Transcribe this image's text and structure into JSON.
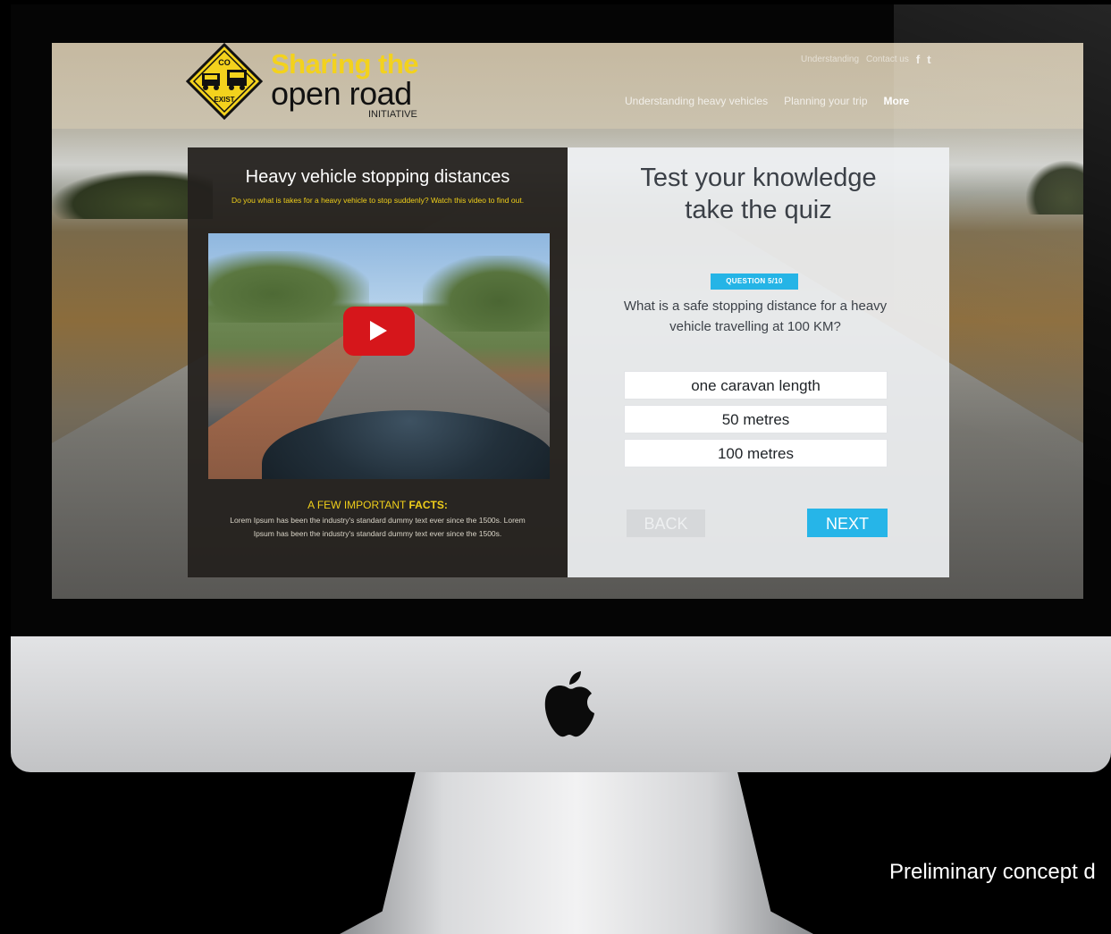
{
  "logo": {
    "sign_top": "CO",
    "sign_bottom": "EXIST",
    "title_line1": "Sharing the",
    "title_line2": "open road",
    "subtitle": "INITIATIVE"
  },
  "nav": {
    "top_links": [
      "Understanding",
      "Contact us"
    ],
    "social": [
      "f",
      "t"
    ],
    "main": [
      "Understanding heavy vehicles",
      "Planning your trip",
      "More"
    ]
  },
  "video_panel": {
    "title": "Heavy vehicle stopping distances",
    "subtitle": "Do you what is takes for a heavy vehicle to stop suddenly? Watch this video to find out.",
    "facts_heading_prefix": "A FEW IMPORTANT ",
    "facts_heading_bold": "FACTS:",
    "facts_body": "Lorem Ipsum has been the industry's standard dummy text ever since the 1500s. Lorem Ipsum has been the industry's standard dummy text ever since the 1500s."
  },
  "quiz": {
    "title_line1": "Test your knowledge",
    "title_line2": "take the quiz",
    "badge": "QUESTION 5/10",
    "question": "What is a safe stopping distance for a heavy vehicle travelling at 100 KM?",
    "answers": [
      "one caravan length",
      "50 metres",
      "100 metres"
    ],
    "back_label": "BACK",
    "next_label": "NEXT"
  },
  "caption": "Preliminary concept d",
  "colors": {
    "accent_blue": "#26b5e8",
    "logo_yellow": "#f3d21d",
    "youtube_red": "#d6161b"
  },
  "icons": {
    "play": "play-icon",
    "apple": "apple-icon",
    "facebook": "facebook-icon",
    "twitter": "twitter-icon"
  }
}
